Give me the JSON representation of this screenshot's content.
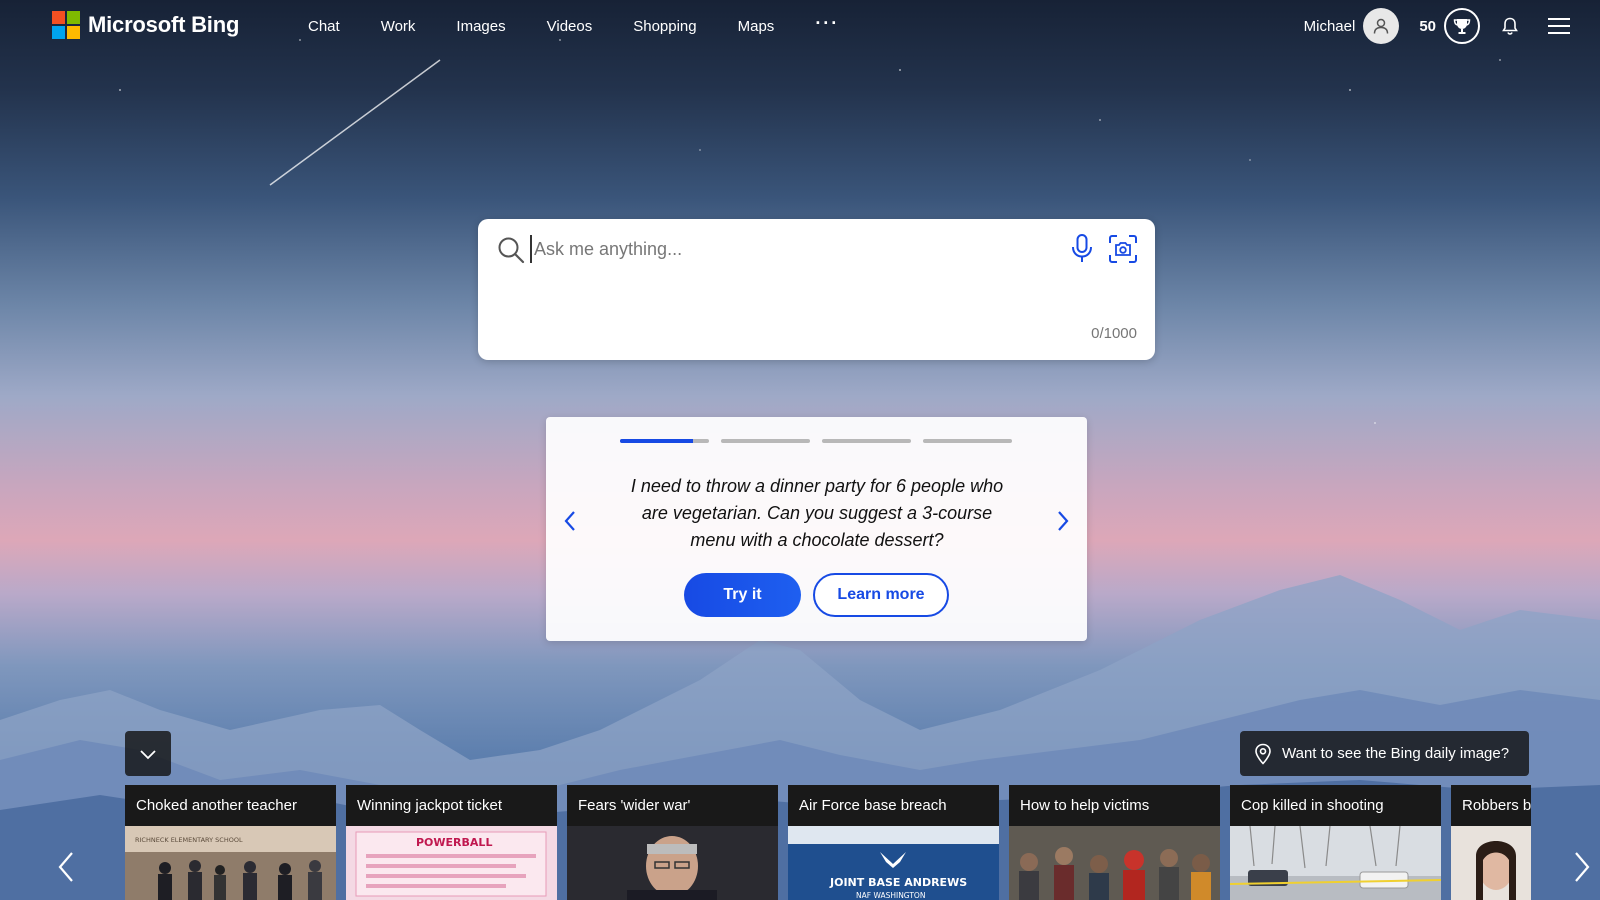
{
  "header": {
    "brand": "Microsoft Bing",
    "nav": [
      "Chat",
      "Work",
      "Images",
      "Videos",
      "Shopping",
      "Maps"
    ],
    "more": "···",
    "user_name": "Michael",
    "points": "50"
  },
  "search": {
    "placeholder": "Ask me anything...",
    "char_count": "0/1000"
  },
  "carousel": {
    "prompt": "I need to throw a dinner party for 6 people who are vegetarian. Can you suggest a 3-course menu with a chocolate dessert?",
    "try_label": "Try it",
    "learn_label": "Learn more",
    "active_slide": 1,
    "total_slides": 4,
    "active_progress": 0.82
  },
  "daily_image": {
    "label": "Want to see the Bing daily image?"
  },
  "news": [
    {
      "title": "Choked another teacher",
      "thumb": "school"
    },
    {
      "title": "Winning jackpot ticket",
      "thumb": "ticket"
    },
    {
      "title": "Fears 'wider war'",
      "thumb": "portrait"
    },
    {
      "title": "Air Force base breach",
      "thumb": "sign"
    },
    {
      "title": "How to help victims",
      "thumb": "crowd"
    },
    {
      "title": "Cop killed in shooting",
      "thumb": "street"
    },
    {
      "title": "Robbers be",
      "thumb": "woman"
    }
  ],
  "thumb_text": {
    "school": "RICHNECK ELEMENTARY SCHOOL",
    "ticket": "POWERBALL",
    "sign_line1": "JOINT BASE ANDREWS",
    "sign_line2": "NAF WASHINGTON"
  },
  "colors": {
    "accent": "#174ae4",
    "ms_red": "#f25022",
    "ms_green": "#7fba00",
    "ms_blue": "#00a4ef",
    "ms_yellow": "#ffb900"
  }
}
